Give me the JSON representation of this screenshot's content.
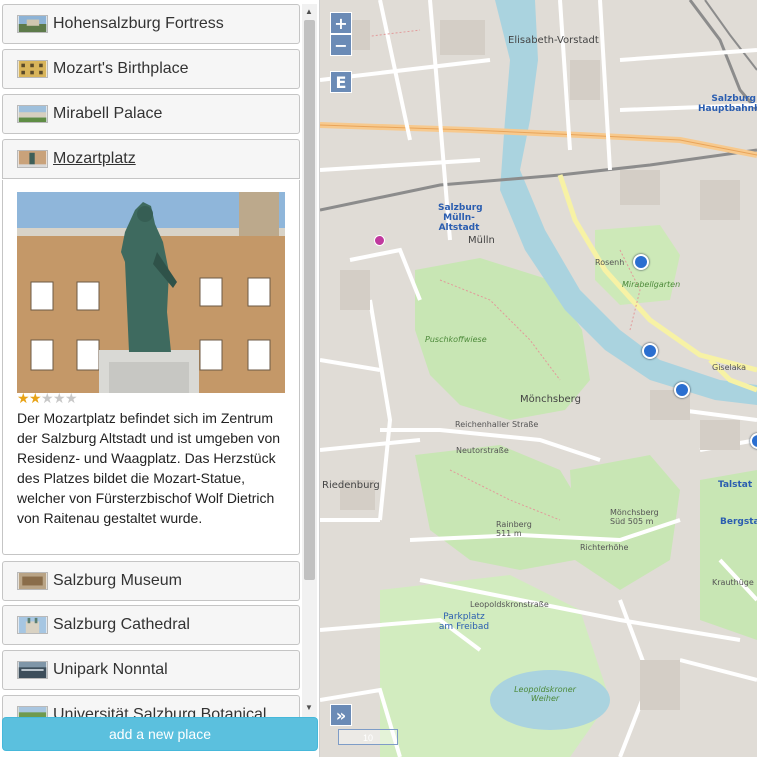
{
  "places": [
    {
      "label": "Hohensalzburg Fortress"
    },
    {
      "label": "Mozart's Birthplace"
    },
    {
      "label": "Mirabell Palace"
    },
    {
      "label": "Mozartplatz"
    },
    {
      "label": "Salzburg Museum"
    },
    {
      "label": "Salzburg Cathedral"
    },
    {
      "label": "Unipark Nonntal"
    },
    {
      "label": "Universität Salzburg Botanical"
    }
  ],
  "selected": {
    "rating": 2,
    "rating_max": 5,
    "description": "Der Mozartplatz befindet sich im Zentrum der Salzburg Altstadt und ist umgeben von Residenz- und Waagplatz. Das Herzstück des Platzes bildet die Mozart-Statue, welcher von Fürsterzbischof Wolf Dietrich von Raitenau gestaltet wurde."
  },
  "add_button": "add a new place",
  "map": {
    "zoom_in": "+",
    "zoom_out": "−",
    "edit": "E",
    "expand": "»",
    "scale_text": "10",
    "labels": {
      "elisabeth": "Elisabeth-Vorstadt",
      "hauptbahnhof": "Salzburg Hauptbahnhof",
      "muelln_station": "Salzburg Mülln-Altstadt",
      "muelln": "Mülln",
      "moenchsberg": "Mönchsberg",
      "riedenburg": "Riedenburg",
      "rainberg": "Rainberg 511 m",
      "moenchsberg_sued": "Mönchsberg Süd 505 m",
      "richterhoehe": "Richterhöhe",
      "mirabellgarten": "Mirabellgarten",
      "rosenhuegel": "Rosenh",
      "puschkoffwiese": "Puschkoffwiese",
      "leopoldskroner_weiher": "Leopoldskroner Weiher",
      "parkplatz": "Parkplatz am Freibad",
      "talstation": "Talstat",
      "bergstation": "Bergsta",
      "reichenhaller": "Reichenhaller Straße",
      "neutorstrasse": "Neutorstraße",
      "leopoldskronstrasse": "Leopoldskronstraße",
      "giselakai": "Giselaka",
      "krauthuegel": "Krauthüge"
    }
  },
  "colors": {
    "accent": "#5bc0de",
    "map_control": "#6b8bb6",
    "marker": "#2b6fd0",
    "river": "#aad3df",
    "park": "#c8e6b4"
  }
}
